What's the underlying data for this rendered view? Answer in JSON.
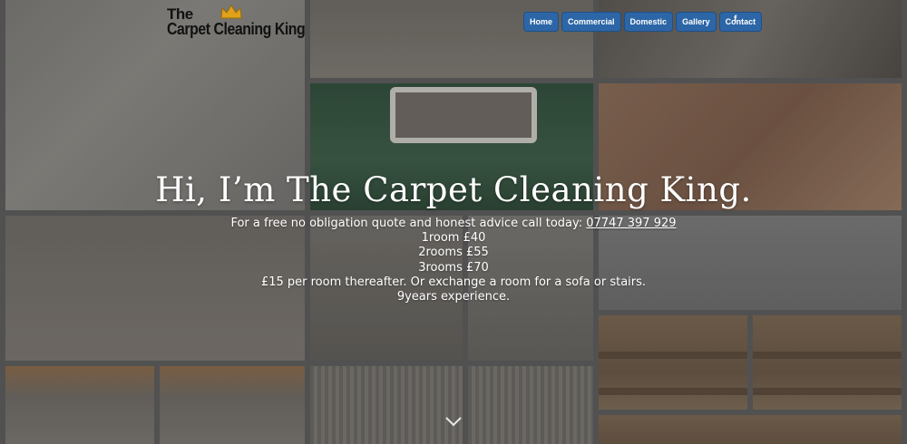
{
  "header": {
    "logo_line1": "The",
    "logo_line2": "Carpet Cleaning King"
  },
  "nav": {
    "items": [
      {
        "label": "Home"
      },
      {
        "label": "Commercial"
      },
      {
        "label": "Domestic"
      },
      {
        "label": "Gallery"
      },
      {
        "label": "Contact"
      }
    ],
    "social_label": "f"
  },
  "hero": {
    "title": "Hi, I’m The Carpet Cleaning King.",
    "intro": "For a free no obligation quote and honest advice call today: ",
    "phone": "07747 397 929",
    "lines": [
      "1room £40",
      "2rooms £55",
      "3rooms £70",
      "£15 per room thereafter. Or exchange a room for a sofa or stairs.",
      "9years experience."
    ]
  },
  "icons": {
    "crown": "crown-icon",
    "facebook": "facebook-icon",
    "scroll": "chevron-down-icon"
  },
  "colors": {
    "nav_button": "#2c66a6",
    "crown": "#e0a21a",
    "text": "#ffffff"
  }
}
